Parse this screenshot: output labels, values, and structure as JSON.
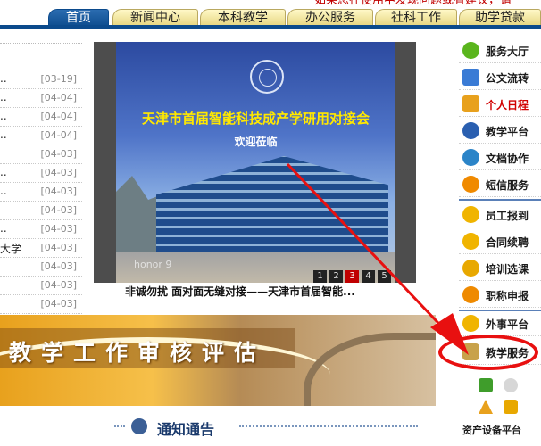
{
  "marquee": "如果您在使用中发现问题或有建议，请",
  "nav": {
    "tabs": [
      {
        "label": "首页",
        "active": true
      },
      {
        "label": "新闻中心"
      },
      {
        "label": "本科教学"
      },
      {
        "label": "办公服务"
      },
      {
        "label": "社科工作"
      },
      {
        "label": "助学贷款"
      }
    ]
  },
  "news": {
    "rows": [
      {
        "text": "..",
        "date": "[03-19]"
      },
      {
        "text": "..",
        "date": "[04-04]"
      },
      {
        "text": "..",
        "date": "[04-04]"
      },
      {
        "text": "..",
        "date": "[04-04]"
      },
      {
        "text": "",
        "date": "[04-03]"
      },
      {
        "text": "..",
        "date": "[04-03]"
      },
      {
        "text": "..",
        "date": "[04-03]"
      },
      {
        "text": "",
        "date": "[04-03]"
      },
      {
        "text": "..",
        "date": "[04-03]"
      },
      {
        "text": "大学",
        "date": "[04-03]"
      },
      {
        "text": "",
        "date": "[04-03]"
      },
      {
        "text": "",
        "date": "[04-03]"
      },
      {
        "text": "",
        "date": "[04-03]"
      }
    ]
  },
  "slideshow": {
    "title": "天津市首届智能科技成产学研用对接会",
    "subtitle": "欢迎莅临",
    "watermark": "honor 9",
    "pages": [
      "1",
      "2",
      "3",
      "4",
      "5"
    ],
    "active_page": 3,
    "caption": "非诚勿扰 面对面无缝对接——天津市首届智能..."
  },
  "banner": {
    "text": "教学工作审核评估"
  },
  "notice": {
    "title": "通知通告"
  },
  "sidebar": {
    "items": [
      {
        "label": "服务大厅",
        "icon": "service-hall-icon",
        "color": "#5ab51d"
      },
      {
        "label": "公文流转",
        "icon": "document-flow-icon",
        "color": "#3a7bd5"
      },
      {
        "label": "个人日程",
        "icon": "schedule-icon",
        "color": "#e8a11d",
        "highlight": true
      },
      {
        "label": "教学平台",
        "icon": "teaching-platform-icon",
        "color": "#2a5fb0"
      },
      {
        "label": "文档协作",
        "icon": "collaboration-icon",
        "color": "#2b84c8"
      },
      {
        "label": "短信服务",
        "icon": "sms-icon",
        "color": "#f08a00"
      },
      {
        "label": "员工报到",
        "icon": "staff-checkin-icon",
        "color": "#f0b400"
      },
      {
        "label": "合同续聘",
        "icon": "contract-icon",
        "color": "#f0b400"
      },
      {
        "label": "培训选课",
        "icon": "training-icon",
        "color": "#e8a800"
      },
      {
        "label": "职称申报",
        "icon": "title-apply-icon",
        "color": "#ef8a00"
      },
      {
        "label": "外事平台",
        "icon": "foreign-affairs-icon",
        "color": "#f0b400"
      },
      {
        "label": "教学服务",
        "icon": "teaching-service-icon",
        "color": "#c8a24a"
      }
    ],
    "asset_label": "资产设备平台"
  },
  "annotation_color": "#e81010"
}
